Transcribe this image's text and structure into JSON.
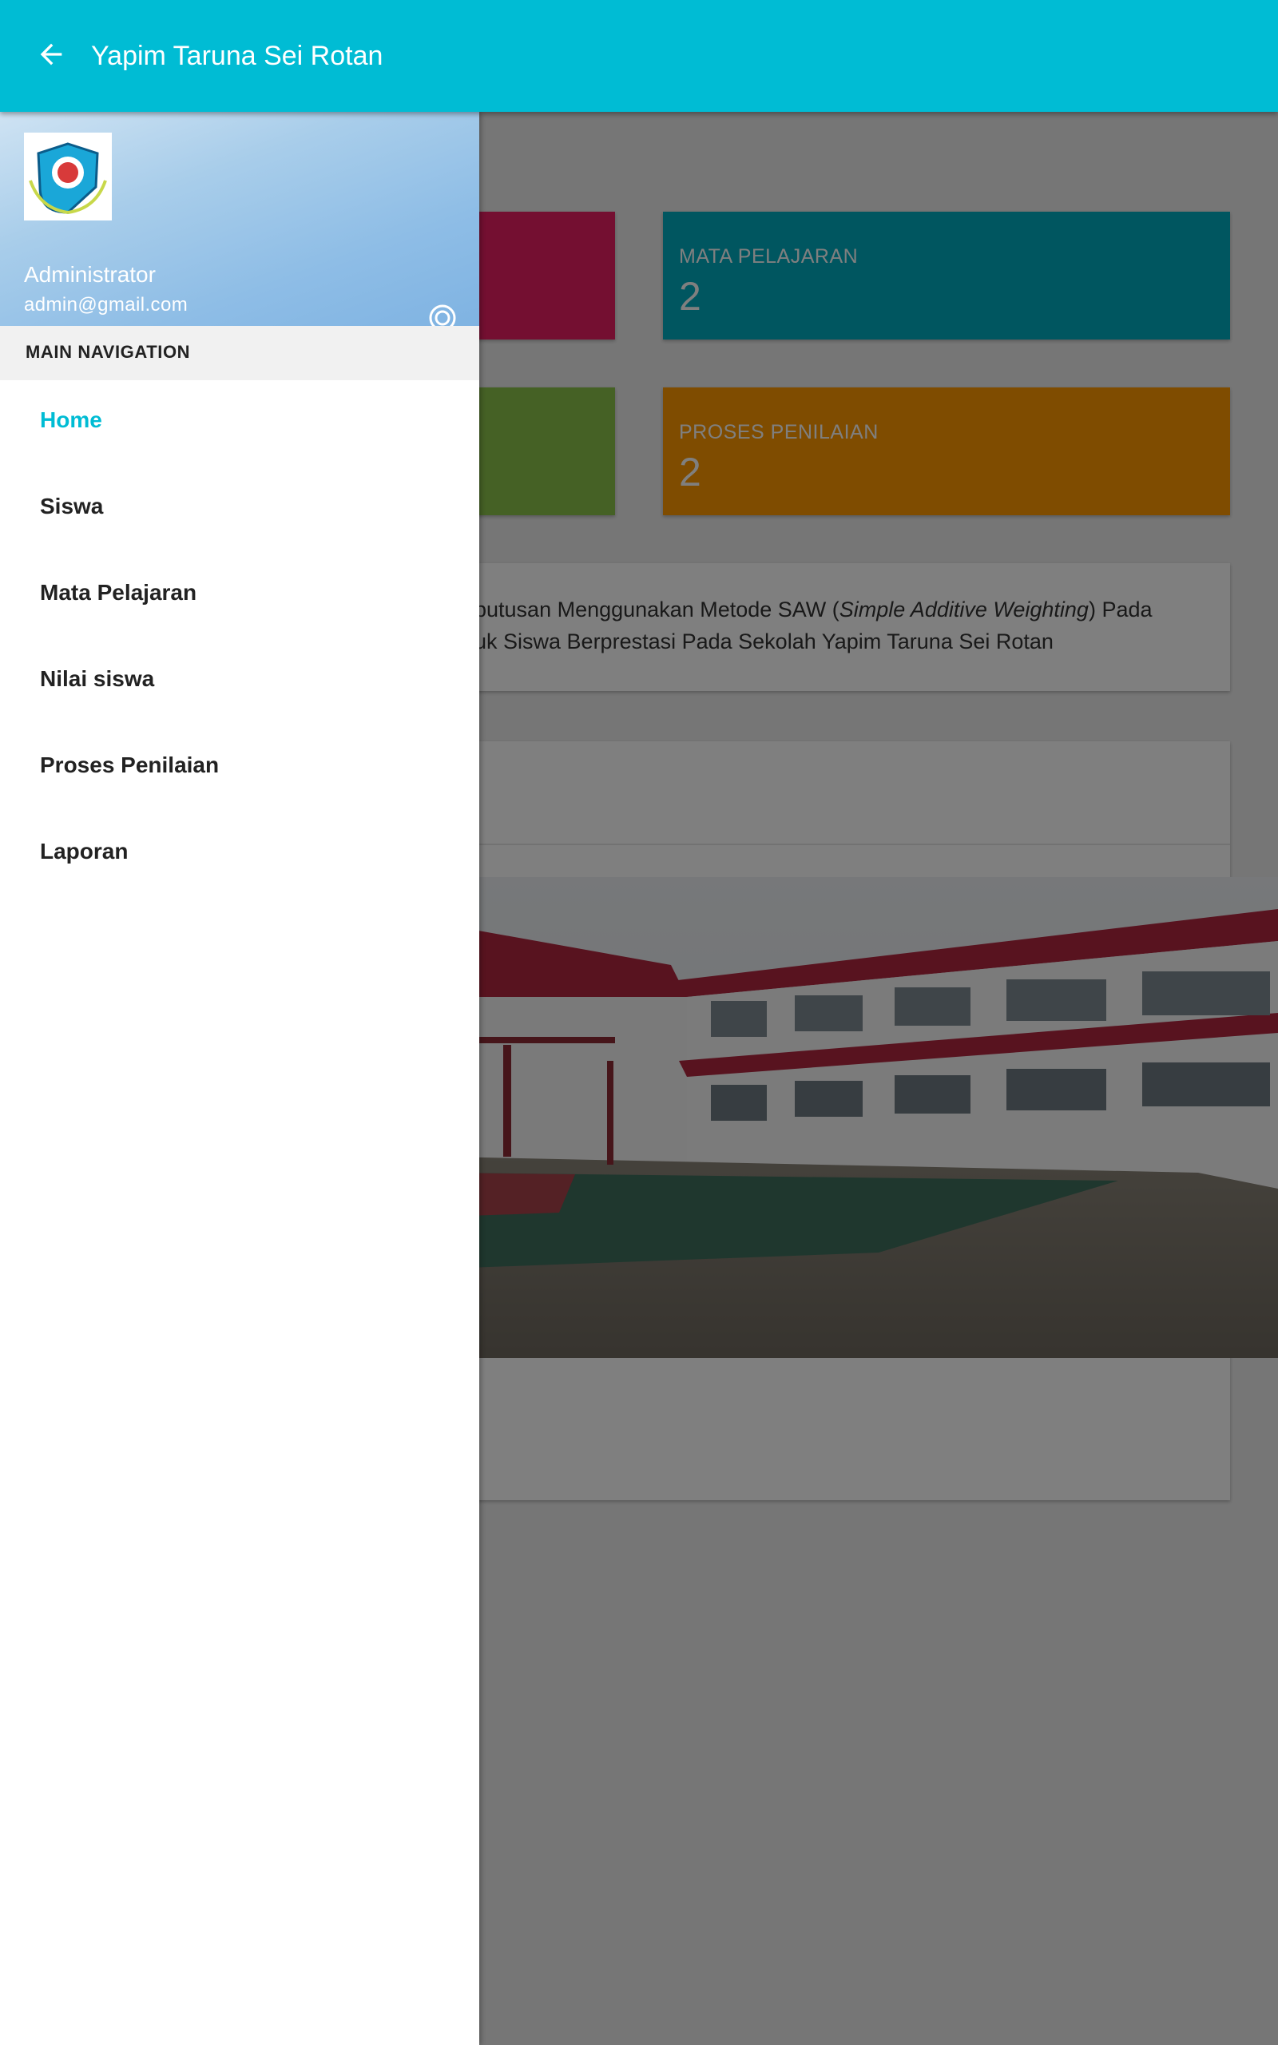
{
  "app_bar": {
    "title": "Yapim Taruna Sei Rotan",
    "back_icon": "arrow-left-icon",
    "color": "#00BCD4"
  },
  "dashboard": {
    "stats": [
      {
        "label": "MATA PELAJARAN",
        "value": "2",
        "color": "#00ACC1"
      },
      {
        "label": "PROSES PENILAIAN",
        "value": "2",
        "color": "#FF9800"
      }
    ],
    "card_colors": [
      "#E91E63",
      "#00ACC1",
      "#8BC34A",
      "#FF9800"
    ],
    "description": {
      "line1_prefix": "putusan Menggunakan Metode SAW (",
      "line1_italic": "Simple Additive Weighting",
      "line1_suffix": ") Pada",
      "line2": "uk Siswa Berprestasi Pada Sekolah Yapim Taruna Sei Rotan"
    }
  },
  "drawer": {
    "user": {
      "name": "Administrator",
      "email": "admin@gmail.com"
    },
    "account_toggle_icon": "radio-target-icon",
    "section_title": "MAIN NAVIGATION",
    "items": [
      {
        "label": "Home",
        "active": true
      },
      {
        "label": "Siswa",
        "active": false
      },
      {
        "label": "Mata Pelajaran",
        "active": false
      },
      {
        "label": "Nilai siswa",
        "active": false
      },
      {
        "label": "Proses Penilaian",
        "active": false
      },
      {
        "label": "Laporan",
        "active": false
      }
    ],
    "active_color": "#00BCD4"
  }
}
